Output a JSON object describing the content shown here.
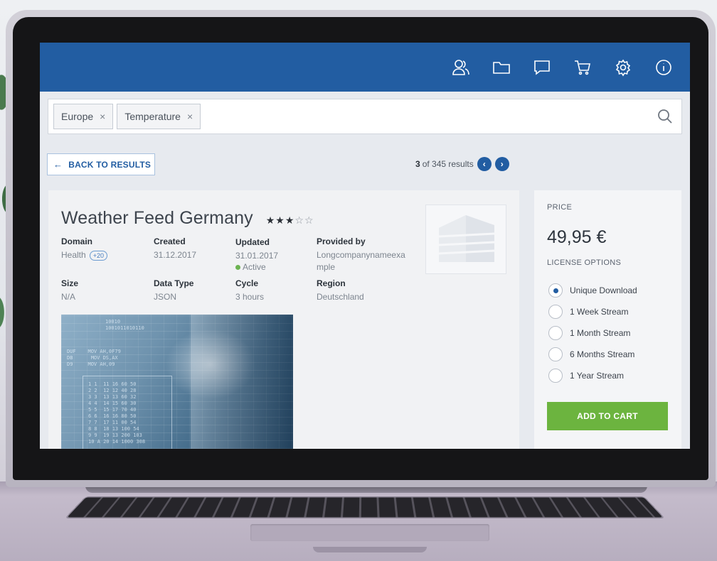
{
  "header": {
    "icons": [
      "users-icon",
      "folder-icon",
      "chat-icon",
      "cart-icon",
      "settings-icon",
      "info-icon"
    ]
  },
  "search": {
    "chips": [
      {
        "label": "Europe",
        "remove": "×"
      },
      {
        "label": "Temperature",
        "remove": "×"
      }
    ]
  },
  "navigation": {
    "back_label": "BACK TO RESULTS",
    "result_index": "3",
    "result_suffix": "of 345 results"
  },
  "dataset": {
    "title": "Weather Feed Germany",
    "rating": 3,
    "rating_max": 5,
    "fields": {
      "domain": {
        "label": "Domain",
        "value": "Health",
        "badge": "+20"
      },
      "created": {
        "label": "Created",
        "value": "31.12.2017"
      },
      "updated": {
        "label": "Updated",
        "value": "31.01.2017",
        "status": "Active"
      },
      "provider": {
        "label": "Provided by",
        "value": "Longcompanynameexa",
        "value2": "mple"
      },
      "size": {
        "label": "Size",
        "value": "N/A"
      },
      "data_type": {
        "label": "Data Type",
        "value": "JSON"
      },
      "cycle": {
        "label": "Cycle",
        "value": "3 hours"
      },
      "region": {
        "label": "Region",
        "value": "Deutschland"
      }
    }
  },
  "pricing": {
    "price_label": "PRICE",
    "price": "49,95 €",
    "license_label": "LICENSE OPTIONS",
    "options": [
      {
        "label": "Unique Download",
        "selected": true
      },
      {
        "label": "1 Week Stream",
        "selected": false
      },
      {
        "label": "1 Month Stream",
        "selected": false
      },
      {
        "label": "6 Months Stream",
        "selected": false
      },
      {
        "label": "1 Year Stream",
        "selected": false
      }
    ],
    "cart_label": "ADD TO CART"
  },
  "colors": {
    "brand_blue": "#225da2",
    "accent_green": "#6cb43f",
    "active_dot": "#6cb351"
  }
}
